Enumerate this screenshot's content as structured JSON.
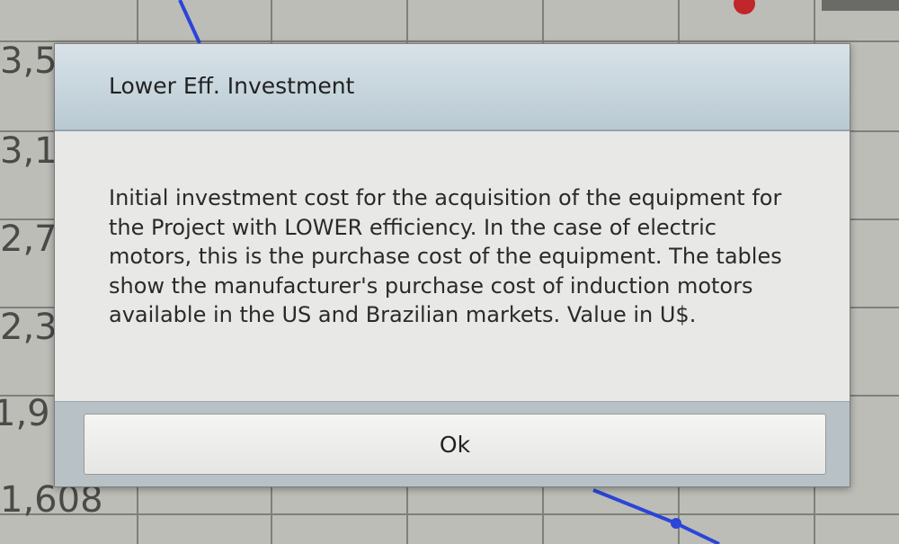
{
  "background_chart": {
    "y_ticks": [
      "3,5",
      "3,1",
      "2,7",
      "2,3",
      "1,9",
      "1,608"
    ]
  },
  "dialog": {
    "title": "Lower Eff. Investment",
    "message": "Initial investment cost for the acquisition of the equipment for the Project with LOWER efficiency. In the case of electric motors, this is the purchase cost of the equipment. The tables show the manufacturer's purchase cost of induction motors available in the US and Brazilian markets. Value in U$.",
    "ok_label": "Ok"
  },
  "colors": {
    "header_bg": "#c8d6de",
    "body_bg": "#e8e8e7",
    "footer_bg": "#b7c1c6",
    "series_line": "#2b45d8",
    "marker_red": "#c0262a"
  }
}
